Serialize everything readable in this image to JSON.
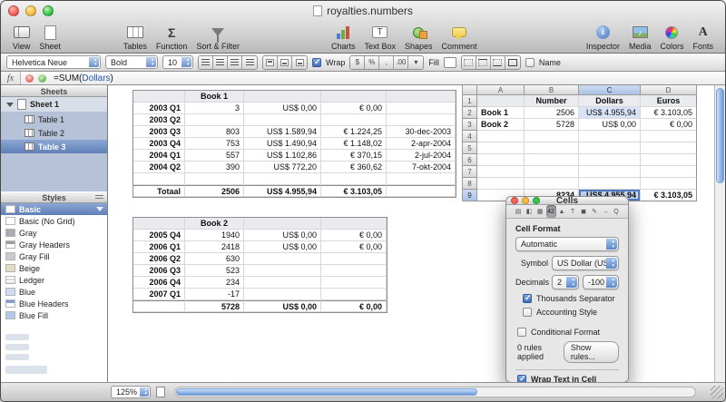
{
  "window": {
    "title": "royalties.numbers"
  },
  "toolbar": {
    "view": "View",
    "sheet": "Sheet",
    "tables": "Tables",
    "function": "Function",
    "sort_filter": "Sort & Filter",
    "charts": "Charts",
    "text_box": "Text Box",
    "shapes": "Shapes",
    "comment": "Comment",
    "inspector": "Inspector",
    "media": "Media",
    "colors": "Colors",
    "fonts": "Fonts"
  },
  "icons": {
    "function_glyph": "Σ",
    "textbox_glyph": "T",
    "inspector_glyph": "i",
    "fonts_glyph": "A",
    "media_glyph": "♪",
    "fx": "fx"
  },
  "format_bar": {
    "font_family": "Helvetica Neue",
    "font_style": "Bold",
    "font_size": "10",
    "wrap_label": "Wrap",
    "wrap_checked": true,
    "btn_currency": "$",
    "btn_percent": "%",
    "btn_comma": ",",
    "btn_decimal": ".00",
    "btn_menu": "▾",
    "fill_label": "Fill",
    "name_label": "Name",
    "name_checked": false
  },
  "formula_bar": {
    "prefix": "=SUM(",
    "ref": "Dollars",
    "suffix": ")"
  },
  "sidebar": {
    "sheets_header": "Sheets",
    "sheet1": "Sheet 1",
    "tables": [
      {
        "label": "Table 1"
      },
      {
        "label": "Table 2"
      },
      {
        "label": "Table 3",
        "selected": true
      }
    ],
    "styles_header": "Styles",
    "styles": [
      {
        "label": "Basic",
        "selected": true
      },
      {
        "label": "Basic (No Grid)"
      },
      {
        "label": "Gray"
      },
      {
        "label": "Gray Headers"
      },
      {
        "label": "Gray Fill"
      },
      {
        "label": "Beige"
      },
      {
        "label": "Ledger"
      },
      {
        "label": "Blue"
      },
      {
        "label": "Blue Headers"
      },
      {
        "label": "Blue Fill"
      }
    ]
  },
  "book1": {
    "title": "Book 1",
    "rows": [
      {
        "c0": "2003 Q1",
        "c1": "3",
        "c2": "US$ 0,00",
        "c3": "€ 0,00",
        "c4": ""
      },
      {
        "c0": "2003 Q2",
        "c1": "",
        "c2": "",
        "c3": "",
        "c4": ""
      },
      {
        "c0": "2003 Q3",
        "c1": "803",
        "c2": "US$ 1.589,94",
        "c3": "€ 1.224,25",
        "c4": "30-dec-2003"
      },
      {
        "c0": "2003 Q4",
        "c1": "753",
        "c2": "US$ 1.490,94",
        "c3": "€ 1.148,02",
        "c4": "2-apr-2004"
      },
      {
        "c0": "2004 Q1",
        "c1": "557",
        "c2": "US$ 1.102,86",
        "c3": "€ 370,15",
        "c4": "2-jul-2004"
      },
      {
        "c0": "2004 Q2",
        "c1": "390",
        "c2": "US$ 772,20",
        "c3": "€ 360,62",
        "c4": "7-okt-2004"
      },
      {
        "c0": "",
        "c1": "",
        "c2": "",
        "c3": "",
        "c4": ""
      },
      {
        "c0": "Totaal",
        "c1": "2506",
        "c2": "US$ 4.955,94",
        "c3": "€ 3.103,05",
        "c4": ""
      }
    ]
  },
  "book2": {
    "title": "Book 2",
    "rows": [
      {
        "c0": "2005 Q4",
        "c1": "1940",
        "c2": "US$ 0,00",
        "c3": "€ 0,00"
      },
      {
        "c0": "2006 Q1",
        "c1": "2418",
        "c2": "US$ 0,00",
        "c3": "€ 0,00"
      },
      {
        "c0": "2006 Q2",
        "c1": "630",
        "c2": "",
        "c3": ""
      },
      {
        "c0": "2006 Q3",
        "c1": "523",
        "c2": "",
        "c3": ""
      },
      {
        "c0": "2006 Q4",
        "c1": "234",
        "c2": "",
        "c3": ""
      },
      {
        "c0": "2007 Q1",
        "c1": "-17",
        "c2": "",
        "c3": ""
      },
      {
        "c0": "",
        "c1": "5728",
        "c2": "US$ 0,00",
        "c3": "€ 0,00"
      }
    ]
  },
  "table3": {
    "cols": [
      "A",
      "B",
      "C",
      "D"
    ],
    "rows": [
      {
        "n": "1",
        "a": "",
        "b": "Number",
        "c": "Dollars",
        "d": "Euros"
      },
      {
        "n": "2",
        "a": "Book 1",
        "b": "2506",
        "c": "US$ 4.955,94",
        "d": "€ 3.103,05"
      },
      {
        "n": "3",
        "a": "Book 2",
        "b": "5728",
        "c": "US$ 0,00",
        "d": "€ 0,00"
      },
      {
        "n": "4",
        "a": "",
        "b": "",
        "c": "",
        "d": ""
      },
      {
        "n": "5",
        "a": "",
        "b": "",
        "c": "",
        "d": ""
      },
      {
        "n": "6",
        "a": "",
        "b": "",
        "c": "",
        "d": ""
      },
      {
        "n": "7",
        "a": "",
        "b": "",
        "c": "",
        "d": ""
      },
      {
        "n": "8",
        "a": "",
        "b": "",
        "c": "",
        "d": ""
      },
      {
        "n": "9",
        "a": "",
        "b": "8234",
        "c": "US$ 4.955,94",
        "d": "€ 3.103,05"
      }
    ]
  },
  "inspector": {
    "title": "Cells",
    "tabs": [
      {
        "name": "document",
        "glyph": "▤"
      },
      {
        "name": "sheet",
        "glyph": "◧"
      },
      {
        "name": "table",
        "glyph": "▦"
      },
      {
        "name": "cells",
        "glyph": "42"
      },
      {
        "name": "chart",
        "glyph": "▲"
      },
      {
        "name": "text",
        "glyph": "T"
      },
      {
        "name": "graphic",
        "glyph": "◼"
      },
      {
        "name": "metrics",
        "glyph": "✎"
      },
      {
        "name": "link",
        "glyph": "→"
      },
      {
        "name": "quicktime",
        "glyph": "Q"
      }
    ],
    "cell_format_label": "Cell Format",
    "format_value": "Automatic",
    "symbol_label": "Symbol",
    "symbol_value": "US Dollar (US$)",
    "decimals_label": "Decimals",
    "decimals_value": "2",
    "negatives_value": "-100",
    "thousands_label": "Thousands Separator",
    "thousands_checked": true,
    "accounting_label": "Accounting Style",
    "accounting_checked": false,
    "conditional_label": "Conditional Format",
    "conditional_checked": false,
    "rules_applied": "0 rules applied",
    "show_rules_label": "Show rules...",
    "wrap_label": "Wrap Text in Cell",
    "wrap_checked": true
  },
  "statusbar": {
    "zoom": "125%"
  }
}
